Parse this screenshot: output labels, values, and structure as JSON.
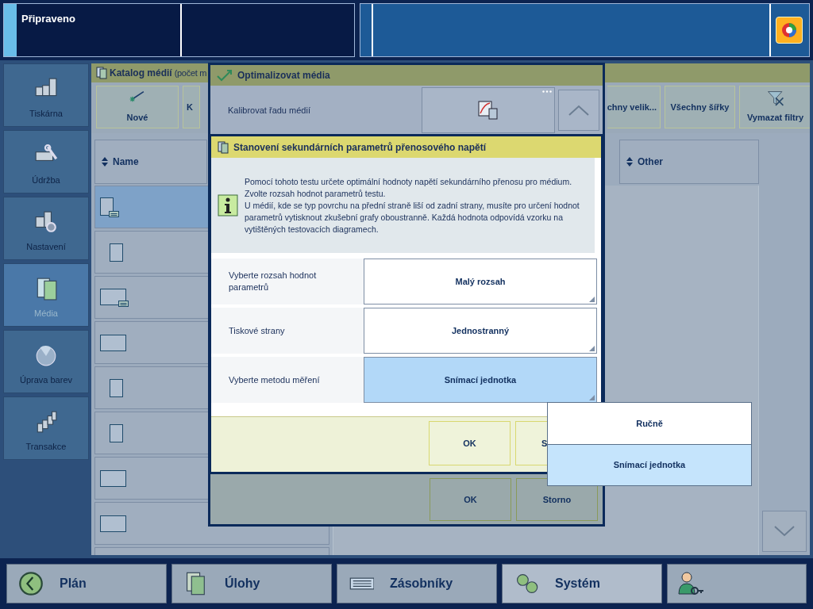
{
  "status_bar": {
    "text": "Připraveno"
  },
  "sidebar": {
    "items": [
      {
        "label": "Tiskárna",
        "selected": false
      },
      {
        "label": "Údržba",
        "selected": false
      },
      {
        "label": "Nastavení",
        "selected": false
      },
      {
        "label": "Média",
        "selected": true
      },
      {
        "label": "Úprava barev",
        "selected": false
      },
      {
        "label": "Transakce",
        "selected": false
      }
    ]
  },
  "catalog": {
    "title": "Katalog médií",
    "title_note": "(počet m",
    "toolbar": [
      "Nové",
      "K",
      "chny velik...",
      "Všechny šířky",
      "Vymazat filtry"
    ],
    "columns": [
      "Name",
      "Other"
    ],
    "rows": [
      {
        "kind": "portrait-tray",
        "selected": true
      },
      {
        "kind": "portrait",
        "selected": false
      },
      {
        "kind": "landscape-tray",
        "selected": false
      },
      {
        "kind": "landscape",
        "selected": false
      },
      {
        "kind": "portrait",
        "selected": false
      },
      {
        "kind": "portrait",
        "selected": false
      },
      {
        "kind": "landscape",
        "selected": false
      },
      {
        "kind": "landscape",
        "selected": false
      },
      {
        "kind": "none",
        "selected": false
      }
    ]
  },
  "back_dialog": {
    "title": "Optimalizovat média",
    "row_label": "Kalibrovat řadu médií",
    "buttons": [
      "OK",
      "Storno"
    ]
  },
  "front_dialog": {
    "title": "Stanovení sekundárních parametrů přenosového napětí",
    "info": "Pomocí tohoto testu určete optimální hodnoty napětí sekundárního přenosu pro médium.\nZvolte rozsah hodnot parametrů testu.\nU médií, kde se typ povrchu na přední straně liší od zadní strany, musíte pro určení hodnot parametrů vytisknout zkušební grafy oboustranně. Každá hodnota odpovídá vzorku na vytištěných testovacích diagramech.",
    "fields": [
      {
        "label": "Vyberte rozsah hodnot parametrů",
        "value": "Malý rozsah",
        "open": false
      },
      {
        "label": "Tiskové strany",
        "value": "Jednostranný",
        "open": false
      },
      {
        "label": "Vyberte metodu měření",
        "value": "Snímací jednotka",
        "open": true
      }
    ],
    "buttons": [
      "OK",
      "S"
    ]
  },
  "dropdown": {
    "options": [
      {
        "label": "Ručně",
        "selected": false
      },
      {
        "label": "Snímací jednotka",
        "selected": true
      }
    ]
  },
  "taskbar": {
    "items": [
      {
        "label": "Plán",
        "selected": false
      },
      {
        "label": "Úlohy",
        "selected": false
      },
      {
        "label": "Zásobníky",
        "selected": false
      },
      {
        "label": "Systém",
        "selected": true
      }
    ]
  }
}
